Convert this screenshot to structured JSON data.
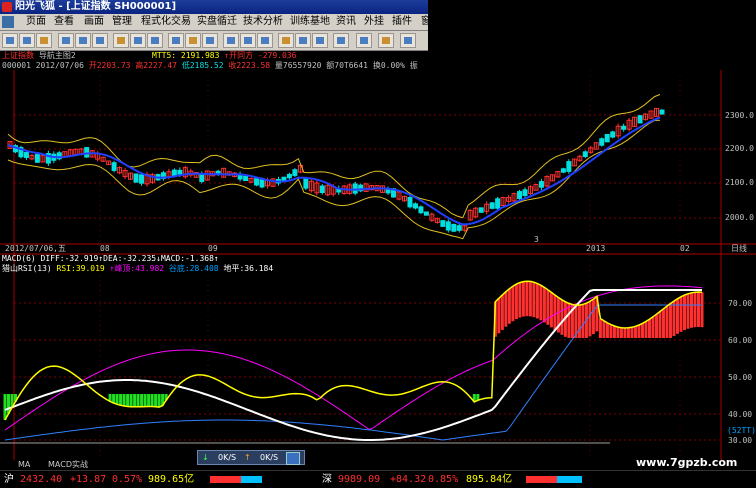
{
  "window": {
    "title": "阳光飞狐 - [上证指数 SH000001]"
  },
  "menu": [
    "页面",
    "查看",
    "画面",
    "管理",
    "程式化交易",
    "实盘循迁",
    "技术分析",
    "训练基地",
    "资讯",
    "外挂",
    "插件",
    "窗"
  ],
  "chart_header": {
    "line1_name": "上证指数",
    "line1_tab": "导航主图2",
    "mtt_label": "MTT5: 2191.983",
    "mtt_change": "↑开同方 -279.036",
    "code": "000001",
    "date": "2012/07/06",
    "open": "开2203.73",
    "high": "高2227.47",
    "low": "低2185.52",
    "close": "收2223.58",
    "volume": "量76557920",
    "amount": "额70T6641",
    "turnover": "换0.00%",
    "amp": "振"
  },
  "price_axis": [
    "2300.0",
    "2200.0",
    "2100.0",
    "2000.0"
  ],
  "date_axis": {
    "start": "2012/07/06,五",
    "ticks": [
      "08",
      "09",
      "3",
      "2013",
      "02"
    ],
    "right_label": "日线"
  },
  "indicator_header": {
    "macd": "MACD(6) DIFF:-32.919↑DEA:-32.235↓MACD:-1.368↑",
    "rsi_name": "猎山RSI(13)",
    "rsi_value": "RSI:39.019",
    "ceiling": "↑峰顶:43.982",
    "valley": "谷底:28.408",
    "floor": "地平:36.184"
  },
  "indicator_axis": [
    "70.00",
    "60.00",
    "50.00",
    "40.00",
    "30.00",
    "20.00"
  ],
  "indicator_tag": "(52TT)",
  "bottom_tabs": [
    "MA",
    "MACD实战"
  ],
  "popup": {
    "down_speed": "0K/S",
    "up_speed": "0K/S"
  },
  "watermark": "www.7gpzb.com",
  "status": {
    "sh_label": "沪",
    "sh_value": "2432.40",
    "sh_change": "+13.87",
    "sh_pct": "0.57%",
    "sh_amount": "989.65亿",
    "sz_label": "深",
    "sz_value": "9989.09",
    "sz_change": "+84.32",
    "sz_pct": "0.85%",
    "sz_amount": "895.84亿"
  },
  "colors": {
    "up": "#ff3030",
    "down": "#00e0e0",
    "yellow": "#ffff00",
    "magenta": "#ff00ff",
    "grid": "#800000"
  }
}
